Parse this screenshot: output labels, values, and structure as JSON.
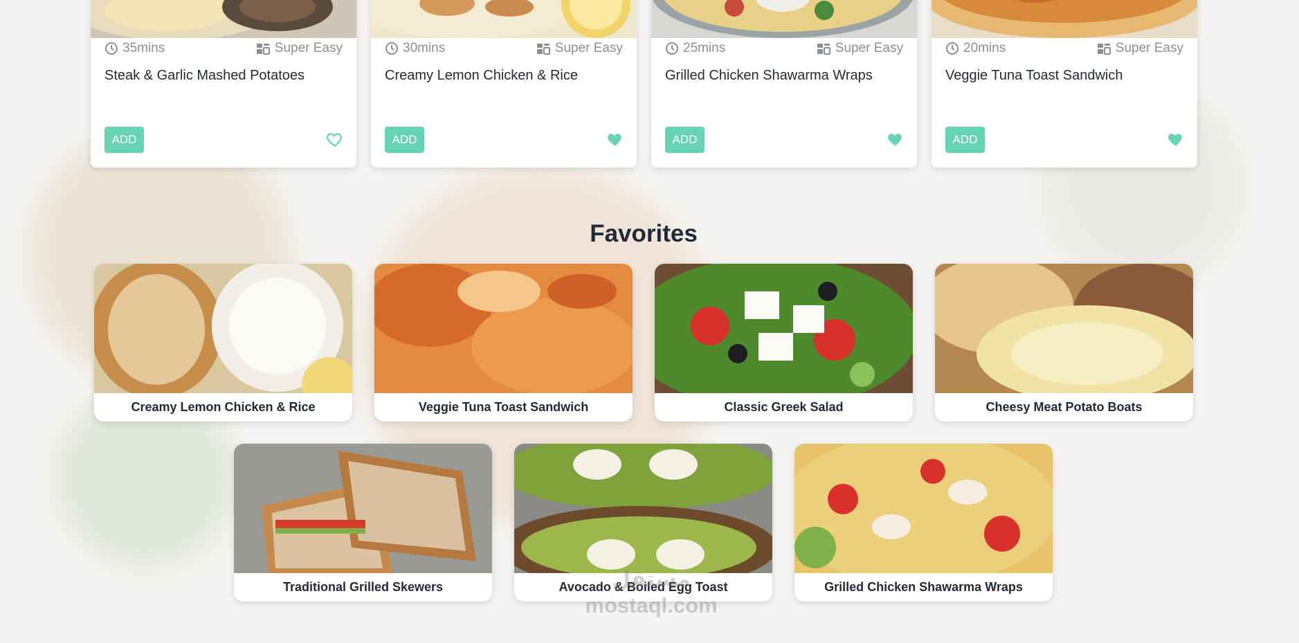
{
  "recipes": [
    {
      "time": "35mins",
      "difficulty": "Super Easy",
      "title": "Steak & Garlic Mashed Potatoes",
      "add_label": "ADD",
      "favorited": false
    },
    {
      "time": "30mins",
      "difficulty": "Super Easy",
      "title": "Creamy Lemon Chicken & Rice",
      "add_label": "ADD",
      "favorited": true
    },
    {
      "time": "25mins",
      "difficulty": "Super Easy",
      "title": "Grilled Chicken Shawarma Wraps",
      "add_label": "ADD",
      "favorited": true
    },
    {
      "time": "20mins",
      "difficulty": "Super Easy",
      "title": "Veggie Tuna Toast Sandwich",
      "add_label": "ADD",
      "favorited": true
    }
  ],
  "favorites": {
    "heading": "Favorites",
    "items": [
      {
        "name": "Creamy Lemon Chicken & Rice"
      },
      {
        "name": "Veggie Tuna Toast Sandwich"
      },
      {
        "name": "Classic Greek Salad"
      },
      {
        "name": "Cheesy Meat Potato Boats"
      },
      {
        "name": "Traditional Grilled Skewers"
      },
      {
        "name": "Avocado & Boiled Egg Toast"
      },
      {
        "name": "Grilled Chicken Shawarma Wraps"
      }
    ]
  },
  "watermark": {
    "line1": "مستقل",
    "line2": "mostaql.com"
  },
  "colors": {
    "accent": "#66d3b4",
    "text": "#1f2a36",
    "muted": "#8a8f96"
  }
}
